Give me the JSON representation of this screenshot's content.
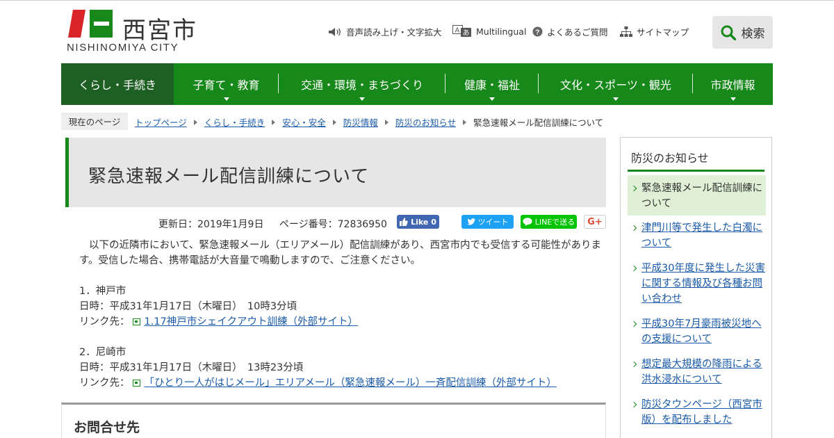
{
  "header": {
    "logo_jp": "西宮市",
    "logo_en": "NISHINOMIYA CITY",
    "utility": {
      "voice": "音声読み上げ・文字拡大",
      "multilingual": "Multilingual",
      "faq": "よくあるご質問",
      "sitemap": "サイトマップ"
    },
    "search_label": "検索"
  },
  "nav": {
    "items": [
      {
        "label": "くらし・手続き"
      },
      {
        "label": "子育て・教育"
      },
      {
        "label": "交通・環境・まちづくり"
      },
      {
        "label": "健康・福祉"
      },
      {
        "label": "文化・スポーツ・観光"
      },
      {
        "label": "市政情報"
      }
    ]
  },
  "breadcrumb": {
    "here_label": "現在のページ",
    "links": [
      "トップページ",
      "くらし・手続き",
      "安心・安全",
      "防災情報",
      "防災のお知らせ"
    ],
    "current": "緊急速報メール配信訓練について"
  },
  "article": {
    "title": "緊急速報メール配信訓練について",
    "updated": "更新日：2019年1月9日",
    "page_no": "ページ番号：72836950",
    "social": {
      "facebook": "Like 0",
      "twitter": "ツイート",
      "line": "LINEで送る",
      "gplus": "G+"
    },
    "intro": "以下の近隣市において、緊急速報メール（エリアメール）配信訓練があり、西宮市内でも受信する可能性があります。受信した場合、携帯電話が大音量で鳴動しますので、ご注意ください。",
    "entries": [
      {
        "city": "1．神戸市",
        "datetime": "日時：平成31年1月17日（木曜日）　10時3分頃",
        "link_prefix": "リンク先：",
        "link_text": "1.17神戸市シェイクアウト訓練（外部サイト）"
      },
      {
        "city": "2．尼崎市",
        "datetime": "日時：平成31年1月17日（木曜日）　13時23分頃",
        "link_prefix": "リンク先：",
        "link_text": "「ひとり一人がはじメール」エリアメール（緊急速報メール）一斉配信訓練（外部サイト）"
      }
    ],
    "contact_heading": "お問合せ先"
  },
  "sidebar": {
    "title": "防災のお知らせ",
    "items": [
      {
        "label": "緊急速報メール配信訓練について"
      },
      {
        "label": "津門川等で発生した白濁について"
      },
      {
        "label": "平成30年度に発生した災害に関する情報及び各種お問い合わせ"
      },
      {
        "label": "平成30年7月豪雨被災地への支援について"
      },
      {
        "label": "想定最大規模の降雨による洪水浸水について"
      },
      {
        "label": "防災タウンページ（西宮市版）を配布しました"
      }
    ]
  },
  "colors": {
    "brand_green": "#17881a",
    "nav_active": "#1e5f24",
    "logo_red": "#d9252a",
    "link_blue": "#1a5aa8"
  },
  "icons": [
    "speaker-icon",
    "translate-icon",
    "question-icon",
    "sitemap-icon",
    "search-icon",
    "external-link-icon",
    "chevron-right-icon"
  ]
}
